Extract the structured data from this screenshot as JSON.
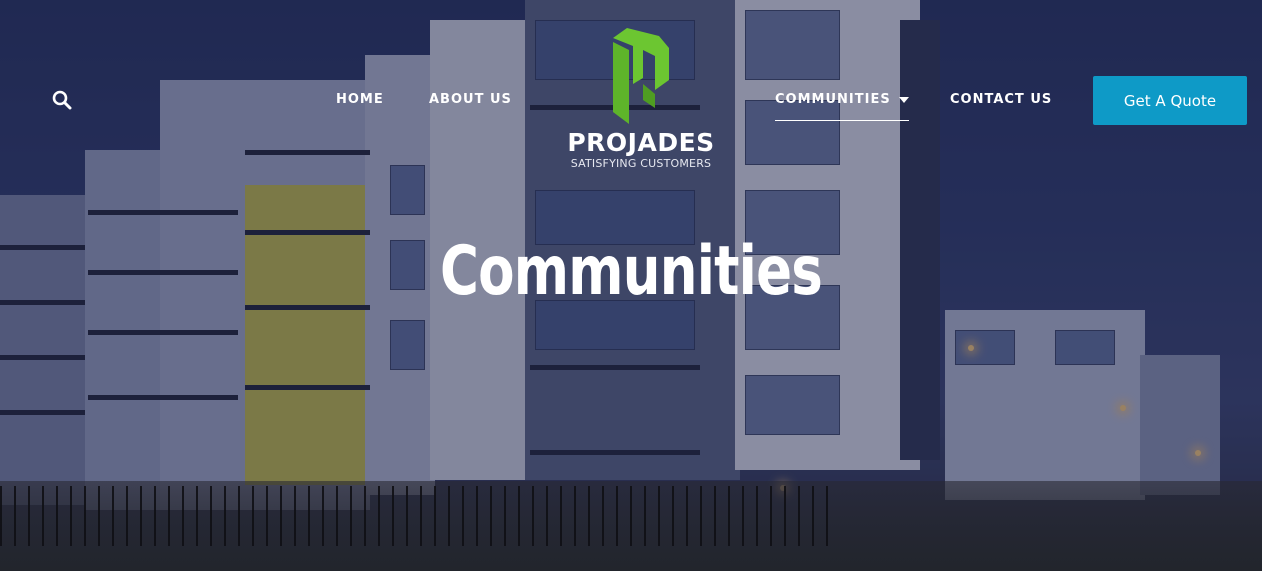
{
  "header": {
    "search_icon": "search-icon",
    "nav": [
      {
        "label": "HOME"
      },
      {
        "label": "ABOUT US"
      },
      {
        "label": "COMMUNITIES",
        "has_dropdown": true,
        "active": true
      },
      {
        "label": "CONTACT US"
      }
    ],
    "logo": {
      "name": "PROJADES",
      "tagline": "SATISFYING CUSTOMERS"
    },
    "cta_label": "Get A Quote"
  },
  "hero": {
    "title": "Communities"
  },
  "colors": {
    "accent": "#0e9ac7",
    "logo_green": "#6cc631",
    "text": "#ffffff"
  }
}
